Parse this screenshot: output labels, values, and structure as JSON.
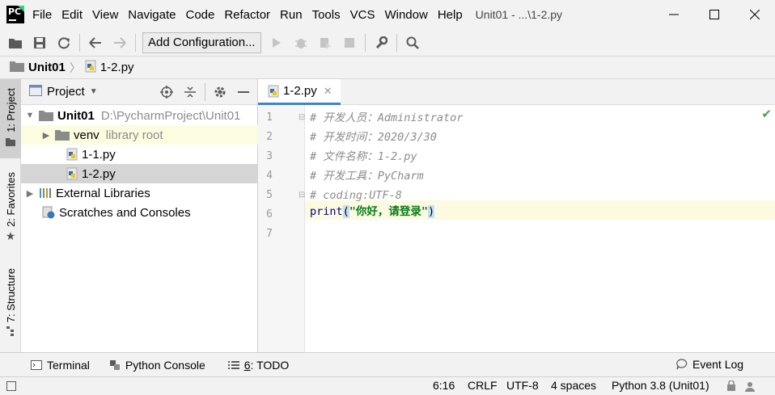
{
  "menubar": {
    "items": [
      "File",
      "Edit",
      "View",
      "Navigate",
      "Code",
      "Refactor",
      "Run",
      "Tools",
      "VCS",
      "Window",
      "Help"
    ],
    "window_title": "Unit01 - ...\\1-2.py"
  },
  "toolbar": {
    "config_label": "Add Configuration..."
  },
  "breadcrumb": {
    "project": "Unit01",
    "file": "1-2.py"
  },
  "left_strip": {
    "project_tab": "1: Project",
    "favorites_tab": "2: Favorites",
    "structure_tab": "7: Structure"
  },
  "project_panel": {
    "title": "Project",
    "tree": {
      "root_name": "Unit01",
      "root_path": "D:\\PycharmProject\\Unit01",
      "venv_name": "venv",
      "venv_note": "library root",
      "file1": "1-1.py",
      "file2": "1-2.py",
      "external_libraries": "External Libraries",
      "scratches": "Scratches and Consoles"
    }
  },
  "editor": {
    "tab_label": "1-2.py",
    "line_numbers": [
      "1",
      "2",
      "3",
      "4",
      "5",
      "6",
      "7"
    ],
    "lines": {
      "l1": "# 开发人员：Administrator",
      "l2": "# 开发时间：2020/3/30",
      "l3": "# 文件名称：1-2.py",
      "l4": "# 开发工具：PyCharm",
      "l5": "# coding:UTF-8",
      "l6_func": "print",
      "l6_open": "(",
      "l6_str": "\"你好，请登录\"",
      "l6_close": ")"
    }
  },
  "toolwindows": {
    "terminal": "Terminal",
    "python_console": "Python Console",
    "todo_prefix": "6",
    "todo_label": ": TODO",
    "event_log": "Event Log"
  },
  "status": {
    "position": "6:16",
    "line_sep": "CRLF",
    "encoding": "UTF-8",
    "indent": "4 spaces",
    "interpreter": "Python 3.8 (Unit01)"
  },
  "colors": {
    "accent": "#4083c9",
    "string": "#067d17",
    "keyword": "#000080",
    "comment": "#8c8c8c",
    "caret_line": "#fcfae1"
  }
}
